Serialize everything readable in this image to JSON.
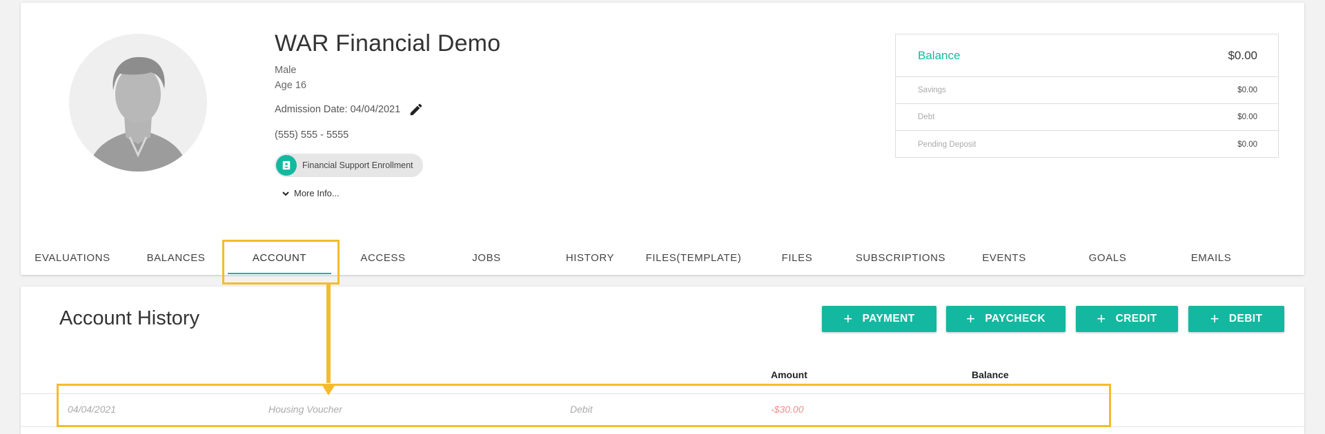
{
  "profile": {
    "name": "WAR Financial Demo",
    "gender": "Male",
    "age": "Age 16",
    "admission": "Admission Date: 04/04/2021",
    "phone": "(555) 555 - 5555",
    "chip_label": "Financial Support Enrollment",
    "more_info": "More Info..."
  },
  "balance": {
    "title": "Balance",
    "total": "$0.00",
    "rows": [
      {
        "label": "Savings",
        "value": "$0.00"
      },
      {
        "label": "Debt",
        "value": "$0.00"
      },
      {
        "label": "Pending Deposit",
        "value": "$0.00"
      }
    ]
  },
  "tabs": [
    "EVALUATIONS",
    "BALANCES",
    "ACCOUNT",
    "ACCESS",
    "JOBS",
    "HISTORY",
    "FILES(TEMPLATE)",
    "FILES",
    "SUBSCRIPTIONS",
    "EVENTS",
    "GOALS",
    "EMAILS"
  ],
  "active_tab": "ACCOUNT",
  "account": {
    "title": "Account History",
    "buttons": [
      "PAYMENT",
      "PAYCHECK",
      "CREDIT",
      "DEBIT"
    ],
    "columns": {
      "amount": "Amount",
      "balance": "Balance"
    },
    "rows": [
      {
        "date": "04/04/2021",
        "description": "Housing Voucher",
        "type": "Debit",
        "amount": "-$30.00",
        "balance": ""
      }
    ]
  },
  "colors": {
    "accent": "#14b8a0",
    "highlight": "#f4bc2c",
    "negative": "#f28b8b"
  }
}
